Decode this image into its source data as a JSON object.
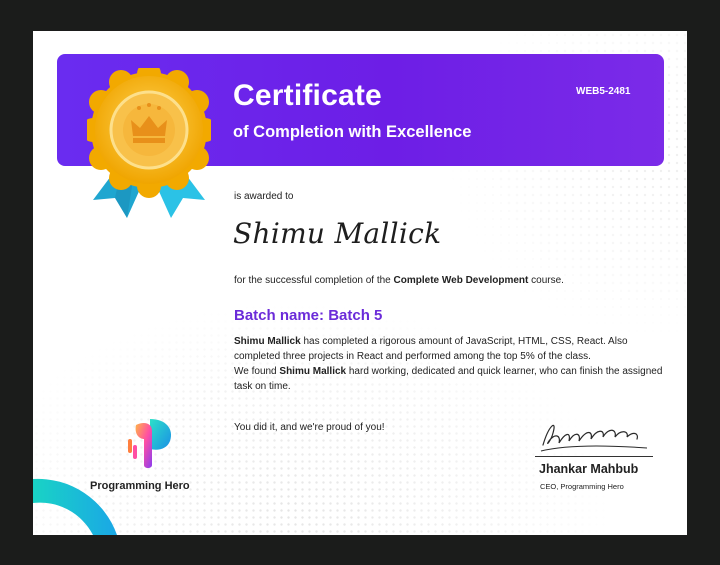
{
  "certificate": {
    "title": "Certificate",
    "subtitle": "of Completion with Excellence",
    "id": "WEB5-2481",
    "awarded_text": "is awarded to",
    "recipient": "Shimu Mallick",
    "completion_prefix": "for the successful completion of the",
    "course_name": "Complete Web Development",
    "completion_suffix": "course.",
    "batch": "Batch name: Batch 5",
    "desc": {
      "name1": "Shimu Mallick",
      "line1_rest": " has completed a rigorous amount of JavaScript, HTML, CSS, React. Also completed three projects in React and performed among the top 5% of the class.",
      "line2_prefix": "We found ",
      "name2": "Shimu Mallick",
      "line2_rest": " hard working, dedicated and quick learner, who can finish the assigned task on time."
    },
    "closing": "You did it, and we're proud of you!",
    "signer_name": "Jhankar Mahbub",
    "signer_role": "CEO, Programming Hero",
    "brand": "Programming Hero"
  },
  "colors": {
    "banner": "#6a2cf0",
    "accent_text": "#6b2bd9",
    "medal_gold": "#f5b400",
    "ribbon": "#2bb6d9"
  },
  "icons": {
    "medal": "award-medal-crown-icon",
    "logo": "programming-hero-logo-icon"
  }
}
